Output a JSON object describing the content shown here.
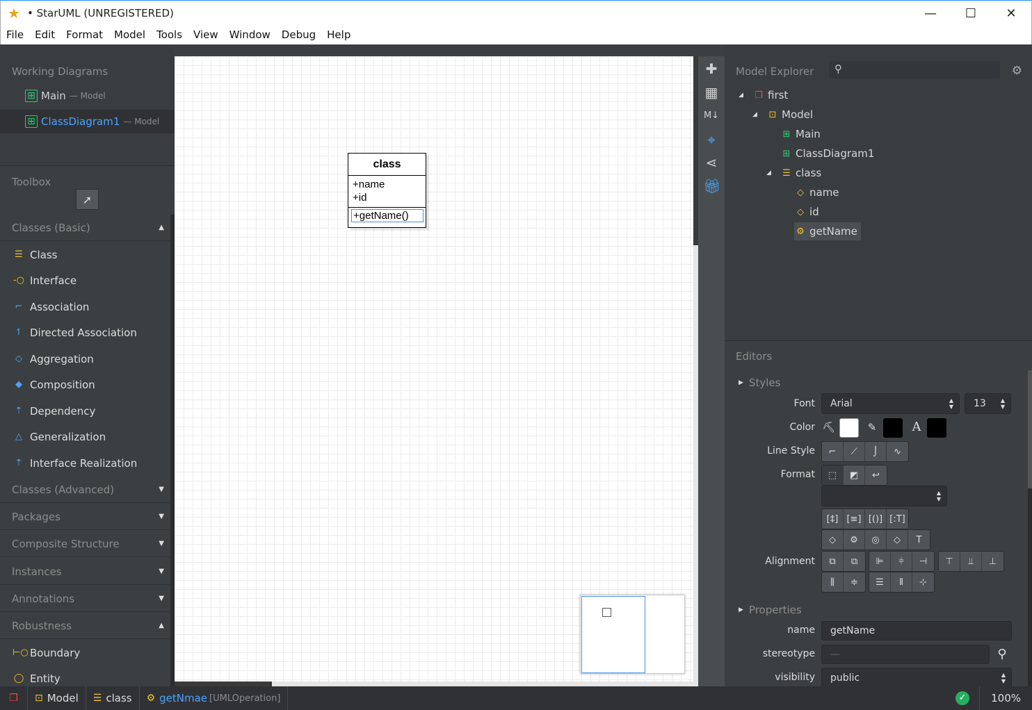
{
  "window": {
    "title": "• StarUML (UNREGISTERED)",
    "minimize": "—",
    "maximize": "☐",
    "close": "✕"
  },
  "menu": [
    "File",
    "Edit",
    "Format",
    "Model",
    "Tools",
    "View",
    "Window",
    "Debug",
    "Help"
  ],
  "working_diagrams": {
    "title": "Working Diagrams",
    "items": [
      {
        "label": "Main",
        "sub": "— Model"
      },
      {
        "label": "ClassDiagram1",
        "sub": "— Model"
      }
    ]
  },
  "toolbox": {
    "title": "Toolbox",
    "classes_basic": "Classes (Basic)",
    "tools": [
      "Class",
      "Interface",
      "Association",
      "Directed Association",
      "Aggregation",
      "Composition",
      "Dependency",
      "Generalization",
      "Interface Realization"
    ],
    "categories": [
      "Classes (Advanced)",
      "Packages",
      "Composite Structure",
      "Instances",
      "Annotations",
      "Robustness"
    ],
    "robustness_tools": [
      "Boundary",
      "Entity"
    ]
  },
  "diagram": {
    "class_name": "class",
    "attributes": [
      "+name",
      "+id"
    ],
    "operations": [
      "+getName()"
    ]
  },
  "model_explorer": {
    "title": "Model Explorer",
    "search_placeholder": "",
    "tree": [
      {
        "label": "first",
        "level": 0
      },
      {
        "label": "Model",
        "level": 1
      },
      {
        "label": "Main",
        "level": 2
      },
      {
        "label": "ClassDiagram1",
        "level": 2
      },
      {
        "label": "class",
        "level": 2
      },
      {
        "label": "name",
        "level": 3
      },
      {
        "label": "id",
        "level": 3
      },
      {
        "label": "getName",
        "level": 3
      }
    ]
  },
  "editors": {
    "title": "Editors",
    "styles": "Styles",
    "font_label": "Font",
    "font_value": "Arial",
    "font_size": "13",
    "color_label": "Color",
    "line_style_label": "Line Style",
    "format_label": "Format",
    "alignment_label": "Alignment",
    "properties": "Properties",
    "name_label": "name",
    "name_value": "getName",
    "stereotype_label": "stereotype",
    "stereotype_value": "—",
    "visibility_label": "visibility",
    "visibility_value": "public",
    "colors": {
      "fill": "#ffffff",
      "line": "#000000",
      "font": "#000000"
    }
  },
  "status": {
    "items": [
      {
        "label": "Model",
        "type": ""
      },
      {
        "label": "class",
        "type": ""
      },
      {
        "label": "getNmae",
        "type": "[UMLOperation]"
      }
    ],
    "zoom": "100%"
  }
}
